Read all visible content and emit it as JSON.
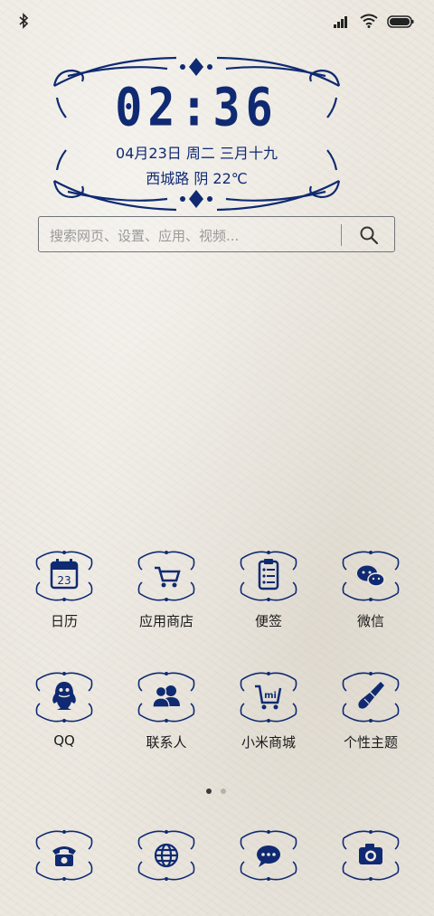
{
  "clock": {
    "time": "02:36",
    "date": "04月23日 周二 三月十九",
    "weather": "西城路 阴 22℃"
  },
  "search": {
    "placeholder": "搜索网页、设置、应用、视频..."
  },
  "apps_row1": [
    {
      "label": "日历",
      "icon": "calendar-icon",
      "day": "23"
    },
    {
      "label": "应用商店",
      "icon": "shopping-cart-icon"
    },
    {
      "label": "便签",
      "icon": "clipboard-icon"
    },
    {
      "label": "微信",
      "icon": "wechat-icon"
    }
  ],
  "apps_row2": [
    {
      "label": "QQ",
      "icon": "penguin-icon"
    },
    {
      "label": "联系人",
      "icon": "contacts-icon"
    },
    {
      "label": "小米商城",
      "icon": "mi-cart-icon",
      "badge": "mi"
    },
    {
      "label": "个性主题",
      "icon": "paintbrush-icon"
    }
  ],
  "dock": [
    {
      "icon": "phone-icon"
    },
    {
      "icon": "globe-icon"
    },
    {
      "icon": "message-icon"
    },
    {
      "icon": "camera-icon"
    }
  ],
  "pages": {
    "count": 2,
    "active": 0
  },
  "colors": {
    "accent": "#0f2a72",
    "background": "#ece8e0",
    "label": "#1a1a1a"
  }
}
